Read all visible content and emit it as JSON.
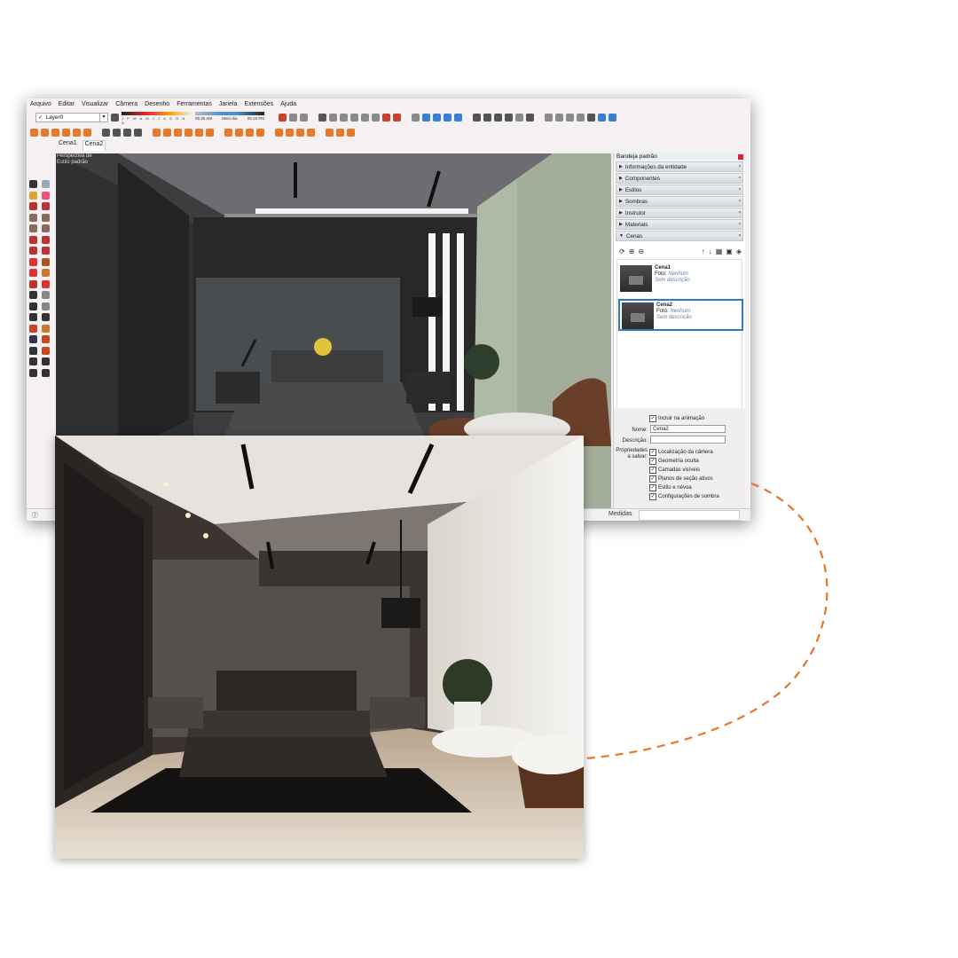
{
  "menu": [
    "Arquivo",
    "Editar",
    "Visualizar",
    "Câmera",
    "Desenho",
    "Ferramentas",
    "Janela",
    "Extensões",
    "Ajuda"
  ],
  "toolbar": {
    "layer_check": "✓",
    "layer_name": "Layer0",
    "months": "J F M A M J J A S O N D",
    "time_start": "05:35 AM",
    "time_mid": "Meio-dia",
    "time_end": "05:15 PM"
  },
  "scene_tabs": [
    "Cena1",
    "Cena2"
  ],
  "viewport": {
    "label_line1": "Perspectiva de",
    "label_line2": "Estilo padrão"
  },
  "tray": {
    "title": "Bandeja padrão",
    "panels": [
      {
        "label": "Informações da entidade",
        "expanded": false
      },
      {
        "label": "Componentes",
        "expanded": false
      },
      {
        "label": "Estilos",
        "expanded": false
      },
      {
        "label": "Sombras",
        "expanded": false
      },
      {
        "label": "Instrutor",
        "expanded": false
      },
      {
        "label": "Materiais",
        "expanded": false
      },
      {
        "label": "Cenas",
        "expanded": true
      }
    ],
    "scenes": [
      {
        "name": "Cena1",
        "foto": "Foto:",
        "foto_value": "Nenhum",
        "desc": "Sem descrição",
        "selected": false
      },
      {
        "name": "Cena2",
        "foto": "Foto:",
        "foto_value": "Nenhum",
        "desc": "Sem descrição",
        "selected": true
      }
    ],
    "include_animation": "Incluir na animação",
    "name_label": "Nome:",
    "name_value": "Cena2",
    "desc_label": "Descrição:",
    "props_label_1": "Propriedades",
    "props_label_2": "a salvar:",
    "properties": [
      "Localização da câmera",
      "Geometria oculta",
      "Camadas visíveis",
      "Planos de seção ativos",
      "Estilo e névoa",
      "Configurações de sombra"
    ]
  },
  "status": {
    "measures_label": "Medidas"
  },
  "colors": {
    "accent_orange": "#e6792a",
    "selection_blue": "#2a7bbf",
    "connector": "#e8752c"
  }
}
